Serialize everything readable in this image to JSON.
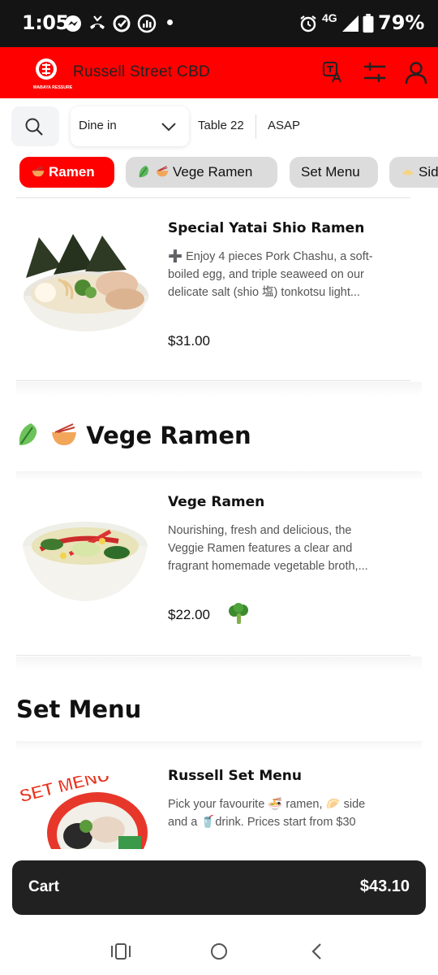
{
  "status_bar": {
    "time": "1:05",
    "network": "4G",
    "battery": "79%",
    "icons": [
      "messenger-icon",
      "missed-call-icon",
      "sync-icon",
      "chart-app-icon",
      "alarm-icon",
      "signal-icon",
      "battery-icon"
    ]
  },
  "header": {
    "brand": "WABAYA RESSURE",
    "store_name": "Russell Street CBD",
    "icons": [
      "translate-icon",
      "filter-sliders-icon",
      "account-icon"
    ],
    "accent_color": "#fe0000"
  },
  "filters": {
    "dine_mode": "Dine in",
    "table": "Table 22",
    "time": "ASAP"
  },
  "categories": [
    {
      "label": "Ramen",
      "active": true
    },
    {
      "label": "Vege Ramen",
      "active": false
    },
    {
      "label": "Set Menu",
      "active": false
    },
    {
      "label": "Sid",
      "active": false
    }
  ],
  "sections": [
    {
      "items": [
        {
          "name": "Special Yatai Shio Ramen",
          "desc_lines": [
            "➕ Enjoy 4 pieces Pork Chashu, a soft-",
            "boiled egg, and triple seaweed on our",
            "delicate salt (shio 塩) tonkotsu light..."
          ],
          "price": "$31.00"
        }
      ]
    },
    {
      "title": "Vege Ramen",
      "items": [
        {
          "name": "Vege Ramen",
          "desc_lines": [
            "Nourishing, fresh and delicious, the",
            "Veggie Ramen features a clear and",
            "fragrant homemade vegetable broth,..."
          ],
          "price": "$22.00",
          "badge_icon": "broccoli-icon"
        }
      ]
    },
    {
      "title": "Set Menu",
      "items": [
        {
          "name": "Russell Set Menu",
          "desc_lines": [
            "Pick your favourite 🍜 ramen, 🥟 side",
            "and a 🥤drink. Prices start from $30"
          ],
          "image_text": "SET MENU"
        }
      ]
    }
  ],
  "cart": {
    "label": "Cart",
    "total": "$43.10"
  },
  "nav": [
    "recent-apps-icon",
    "home-icon",
    "back-icon"
  ]
}
